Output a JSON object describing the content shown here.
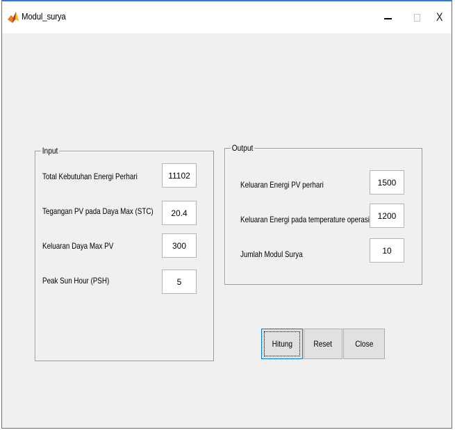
{
  "window": {
    "title": "Modul_surya",
    "controls": {
      "minimize": "minimize",
      "maximize": "maximize",
      "close": "X"
    }
  },
  "input_panel": {
    "title": "Input",
    "fields": [
      {
        "label": "Total Kebutuhan Energi Perhari",
        "value": "11102"
      },
      {
        "label": "Tegangan PV pada Daya Max (STC)",
        "value": "20.4"
      },
      {
        "label": "Keluaran Daya Max PV",
        "value": "300"
      },
      {
        "label": "Peak Sun Hour (PSH)",
        "value": "5"
      }
    ]
  },
  "output_panel": {
    "title": "Output",
    "fields": [
      {
        "label": "Keluaran Energi PV perhari",
        "value": "1500"
      },
      {
        "label": "Keluaran Energi pada temperature operasi",
        "value": "1200"
      },
      {
        "label": "Jumlah Modul Surya",
        "value": "10"
      }
    ]
  },
  "buttons": {
    "hitung": "Hitung",
    "reset": "Reset",
    "close": "Close"
  },
  "icons": {
    "app": "matlab-icon"
  }
}
